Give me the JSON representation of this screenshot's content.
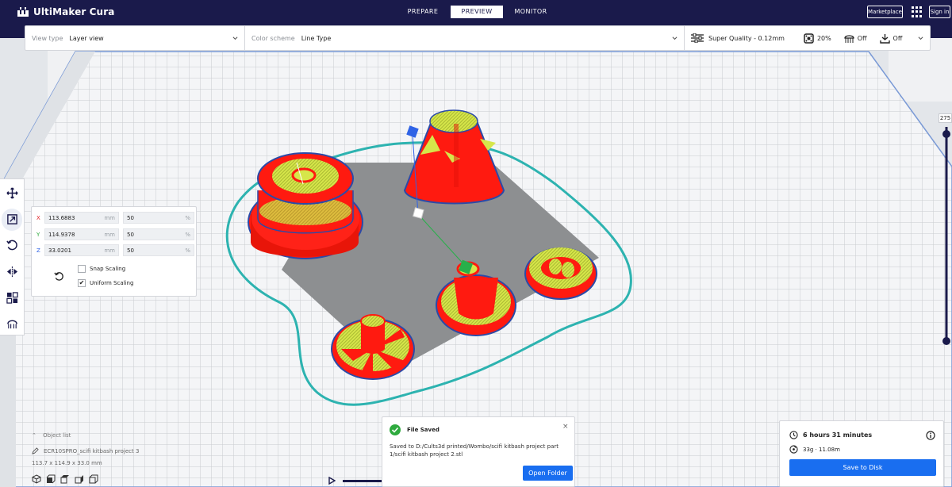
{
  "app": {
    "name": "UltiMaker Cura"
  },
  "stages": [
    {
      "label": "PREPARE"
    },
    {
      "label": "PREVIEW"
    },
    {
      "label": "MONITOR"
    }
  ],
  "header": {
    "marketplace": "Marketplace",
    "sign_in": "Sign in"
  },
  "view_settings": {
    "view_type_label": "View type",
    "view_type_value": "Layer view",
    "color_scheme_label": "Color scheme",
    "color_scheme_value": "Line Type"
  },
  "print_settings": {
    "profile": "Super Quality - 0.12mm",
    "infill": "20%",
    "support": "Off",
    "adhesion": "Off"
  },
  "scale_tool": {
    "x_label": "X",
    "x_value": "113.6883",
    "x_unit": "mm",
    "x_percent": "50",
    "x_percent_unit": "%",
    "y_label": "Y",
    "y_value": "114.9378",
    "y_unit": "mm",
    "y_percent": "50",
    "y_percent_unit": "%",
    "z_label": "Z",
    "z_value": "33.0201",
    "z_unit": "mm",
    "z_percent": "50",
    "z_percent_unit": "%",
    "snap_scaling_label": "Snap Scaling",
    "snap_scaling_checked": false,
    "uniform_scaling_label": "Uniform Scaling",
    "uniform_scaling_checked": true
  },
  "object_list": {
    "title": "Object list",
    "file_name": "ECR10SPRO_scifi kitbash project 3",
    "dimensions": "113.7 x 114.9 x 33.0 mm"
  },
  "layer_slider": {
    "max_layer": "275"
  },
  "toast": {
    "title": "File Saved",
    "message": "Saved to D:/Cults3d printed/Wombo/scifi kitbash project part 1/scifi kitbash project 2.stl",
    "button": "Open Folder",
    "close": "×"
  },
  "print_info": {
    "time": "6 hours 31 minutes",
    "material": "33g · 11.08m",
    "save_button": "Save to Disk"
  },
  "colors": {
    "topbar": "#1a1a4b",
    "accent": "#196ef0",
    "model_red": "#ff1a10",
    "infill_yellow": "#d6e64a",
    "skirt_cyan": "#2db3b0"
  }
}
